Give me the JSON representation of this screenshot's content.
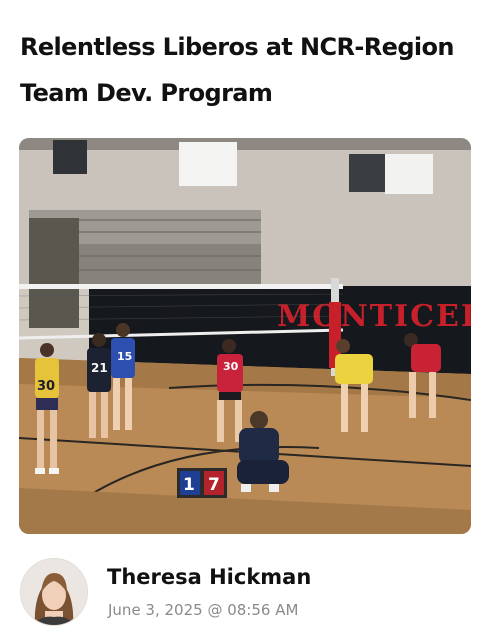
{
  "post": {
    "title": "Relentless Liberos at NCR-Region Team Dev. Program",
    "photo": {
      "banner_text": "MONTICEL",
      "scoreboard_left": "1",
      "scoreboard_right": "7",
      "jersey_numbers": [
        "30",
        "21",
        "15",
        "30"
      ]
    },
    "author": {
      "name": "Theresa Hickman",
      "date": "June 3, 2025 @ 08:56 AM"
    }
  },
  "colors": {
    "title_text": "#111111",
    "meta_text": "#8a8a8a",
    "banner_red": "#c8202a",
    "court_wood": "#b98a55"
  }
}
